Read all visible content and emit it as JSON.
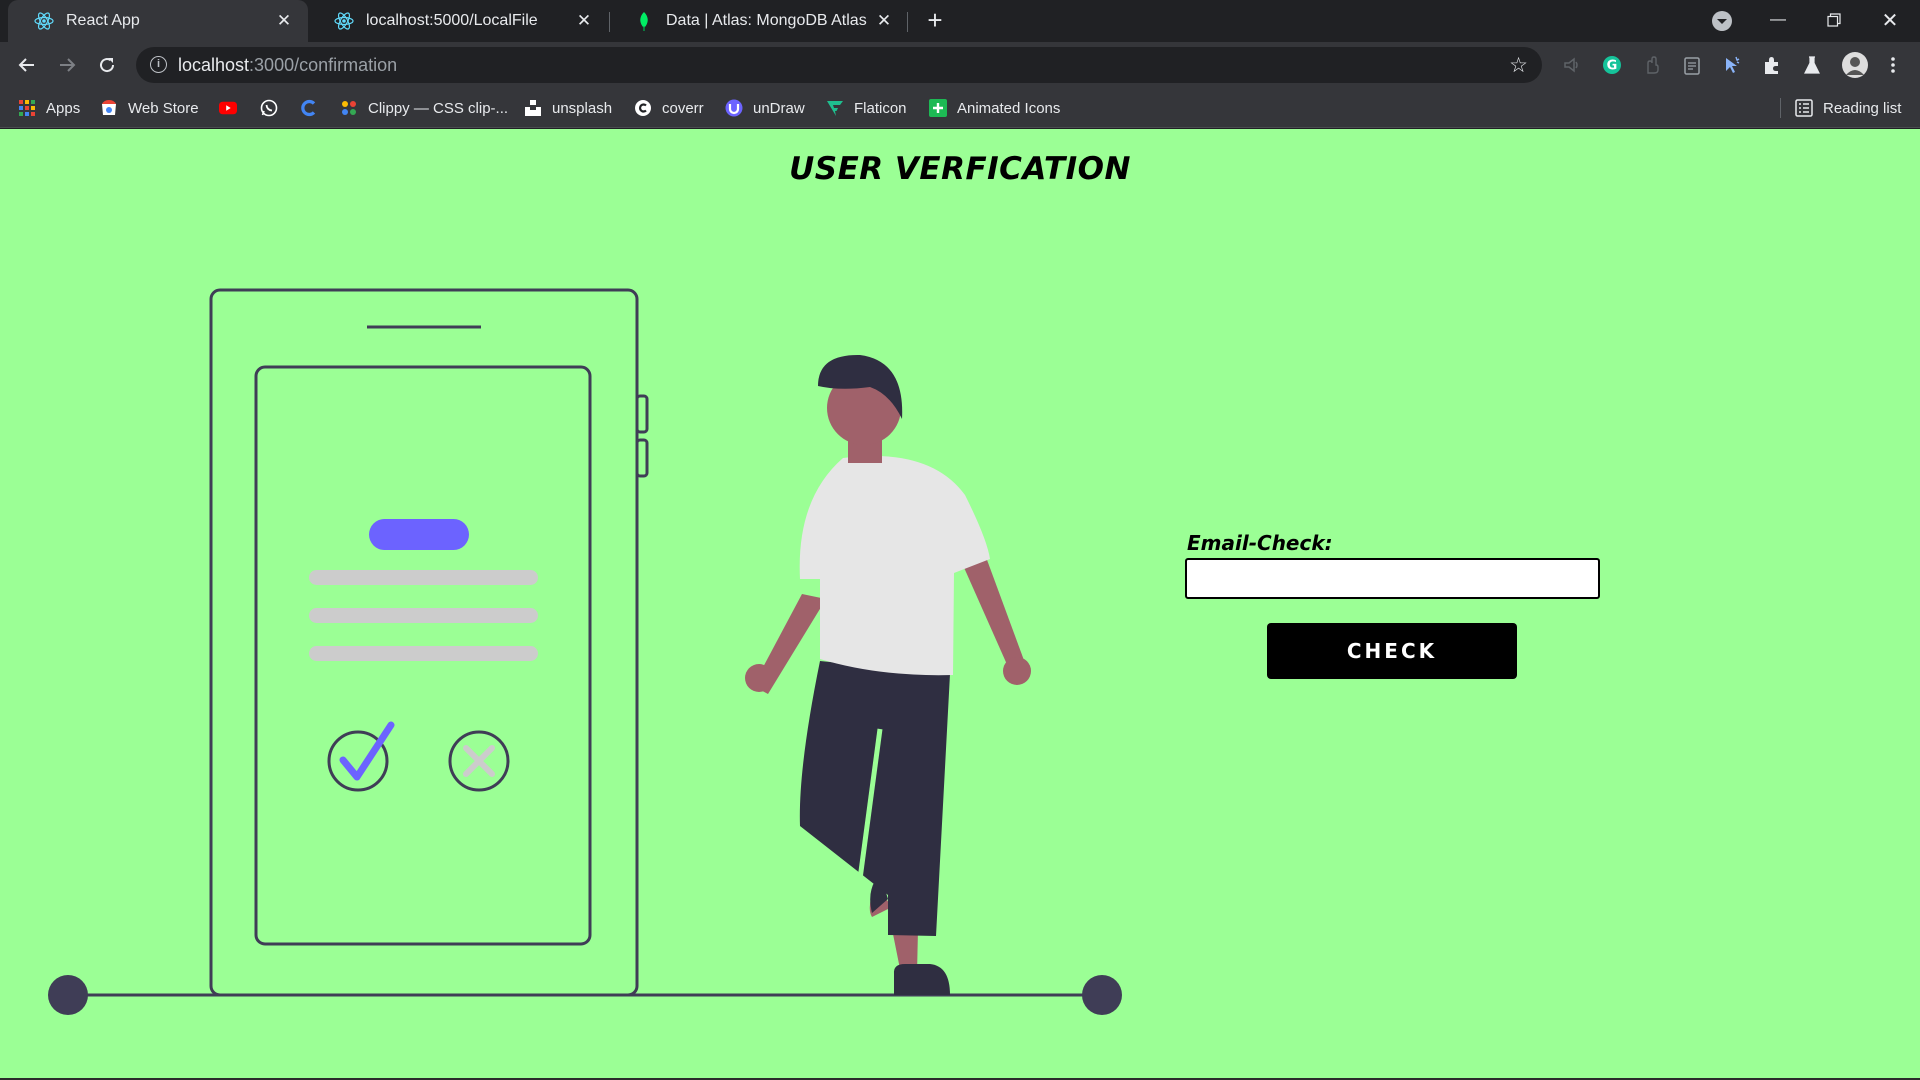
{
  "browser": {
    "tabs": [
      {
        "label": "React App",
        "icon": "react-icon",
        "active": true
      },
      {
        "label": "localhost:5000/LocalFile",
        "icon": "react-icon",
        "active": false
      },
      {
        "label": "Data | Atlas: MongoDB Atlas",
        "icon": "mongodb-leaf-icon",
        "active": false
      }
    ],
    "url_host": "localhost",
    "url_path": ":3000/confirmation",
    "bookmarks": [
      {
        "label": "Apps",
        "icon": "apps-grid-icon"
      },
      {
        "label": "Web Store",
        "icon": "web-store-icon"
      },
      {
        "label": "",
        "icon": "youtube-icon"
      },
      {
        "label": "",
        "icon": "whatsapp-icon"
      },
      {
        "label": "",
        "icon": "c-logo-icon"
      },
      {
        "label": "Clippy — CSS clip-...",
        "icon": "clippy-icon"
      },
      {
        "label": "unsplash",
        "icon": "unsplash-icon"
      },
      {
        "label": "coverr",
        "icon": "coverr-icon"
      },
      {
        "label": "unDraw",
        "icon": "undraw-icon"
      },
      {
        "label": "Flaticon",
        "icon": "flaticon-icon"
      },
      {
        "label": "Animated Icons",
        "icon": "animated-icons-icon"
      }
    ],
    "reading_list": "Reading list"
  },
  "page": {
    "title": "USER VERFICATION",
    "email_label": "Email-Check:",
    "email_value": "",
    "check_button": "CHECK"
  },
  "colors": {
    "page_background": "#9bff95",
    "accent": "#6c63ff",
    "ink": "#3f3d56",
    "skin": "#a0616a",
    "shirt": "#e6e6e6",
    "pants": "#2f2e41",
    "placeholder_lines": "#cccccc"
  }
}
